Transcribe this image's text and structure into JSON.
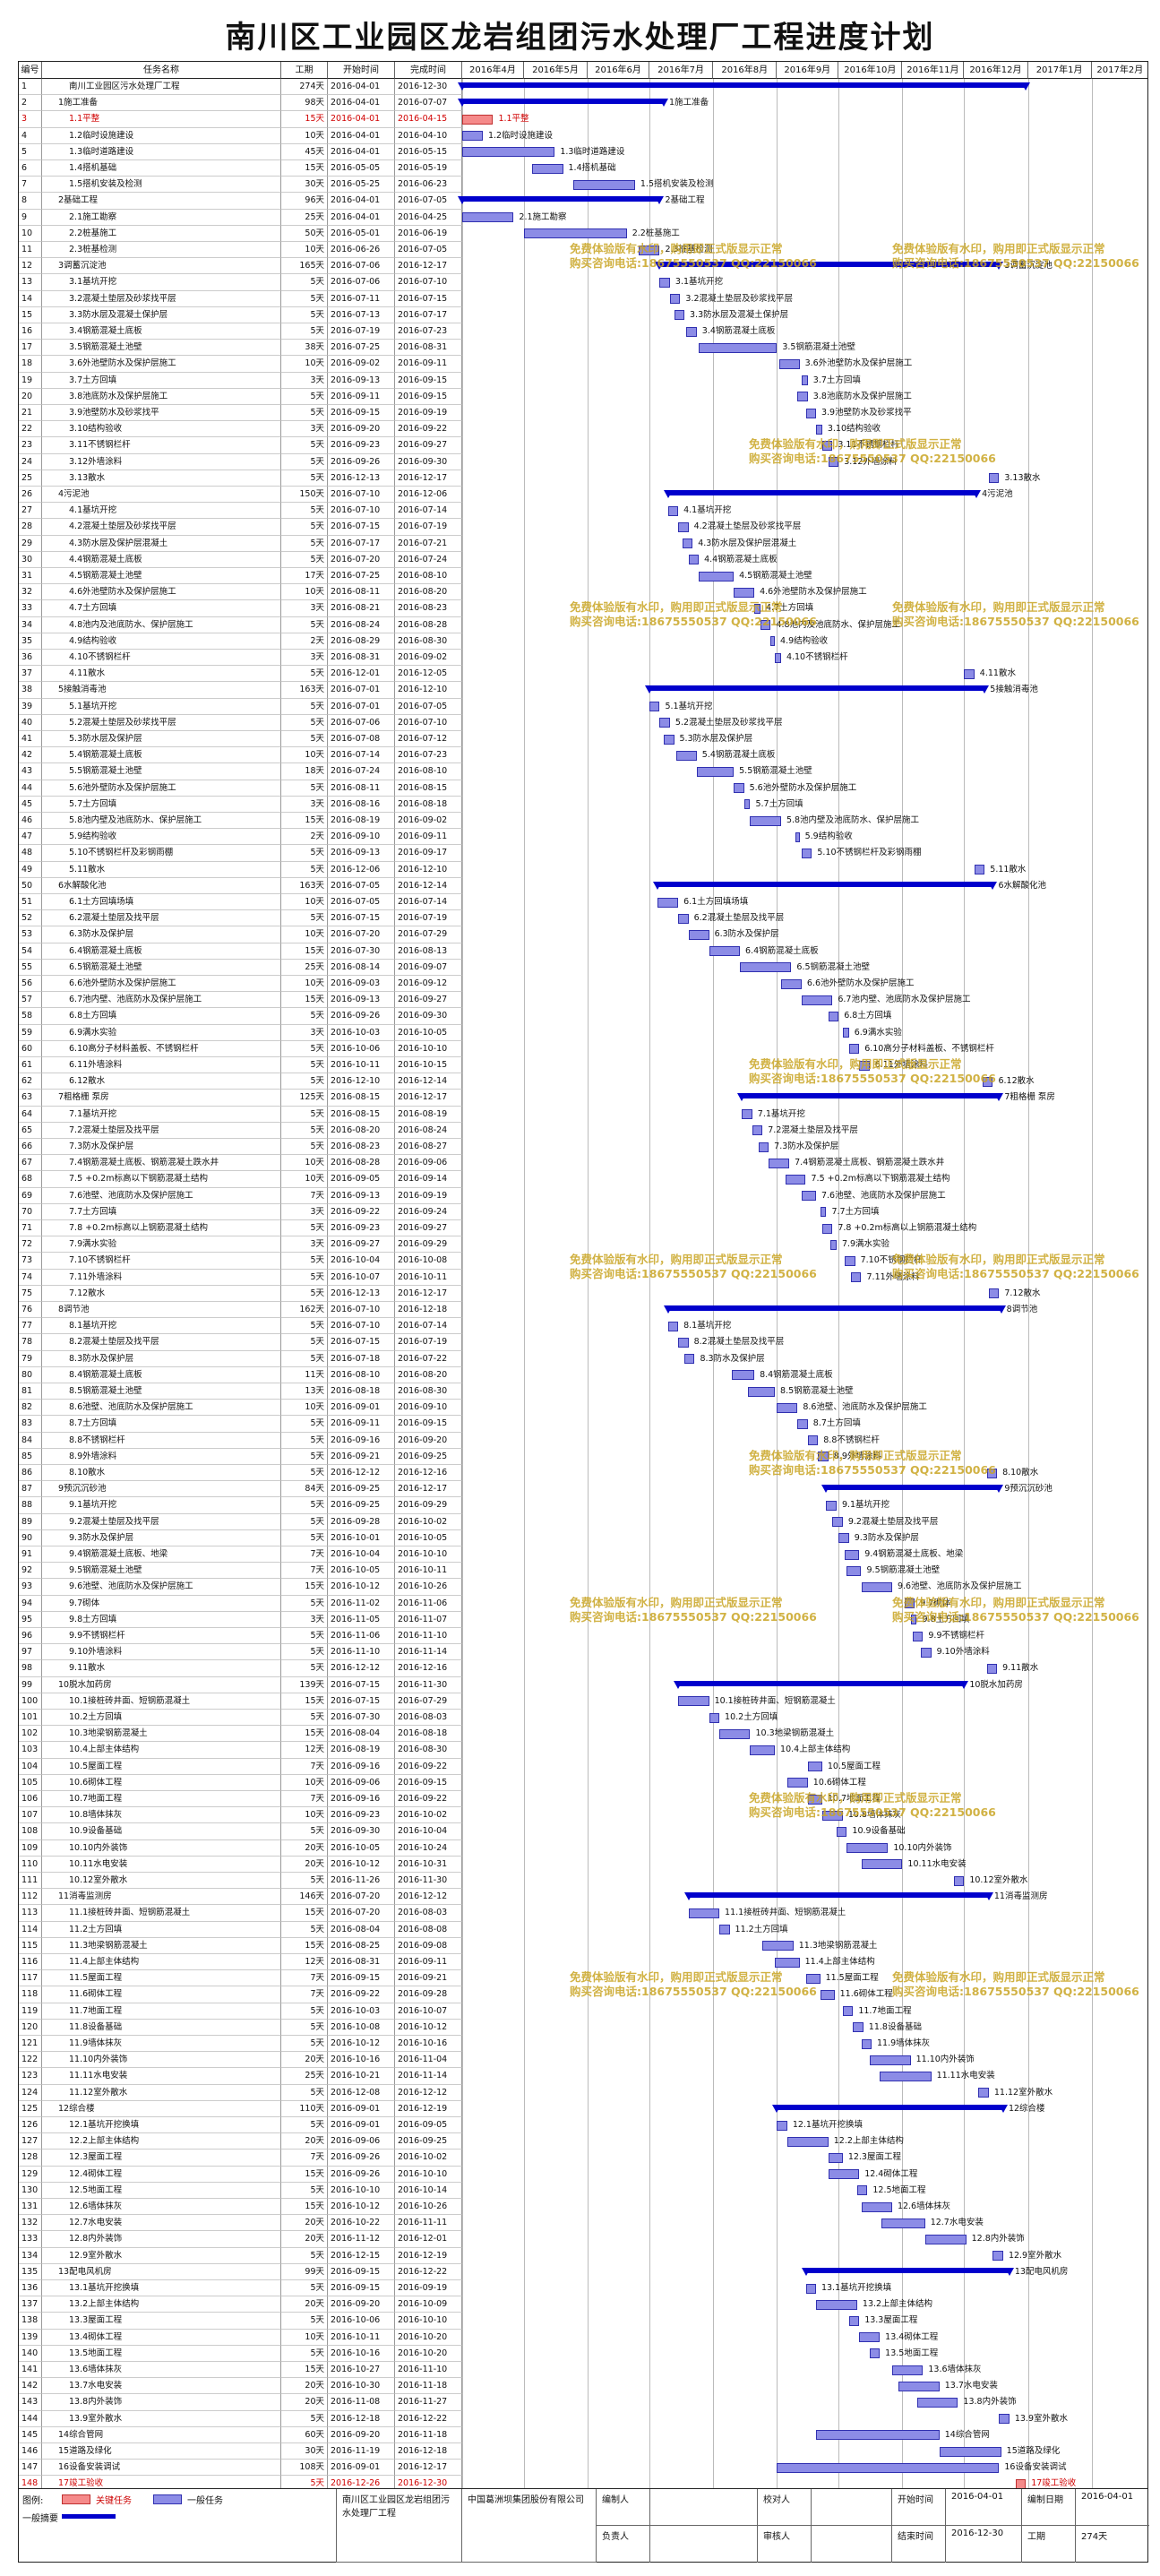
{
  "title": "南川区工业园区龙岩组团污水处理厂工程进度计划",
  "header": {
    "id": "编号",
    "name": "任务名称",
    "duration": "工期",
    "start": "开始时间",
    "end": "完成时间",
    "months": [
      "2016年4月",
      "2016年5月",
      "2016年6月",
      "2016年7月",
      "2016年8月",
      "2016年9月",
      "2016年10月",
      "2016年11月",
      "2016年12月",
      "2017年1月",
      "2017年2月"
    ]
  },
  "chart_data": {
    "type": "gantt",
    "timeline_start": "2016-04-01",
    "timeline_end": "2017-02-28",
    "columns": [
      "id",
      "name",
      "duration",
      "start",
      "end",
      "type"
    ],
    "rows": [
      [
        1,
        "南川工业园区污水处理厂工程",
        "274天",
        "2016-04-01",
        "2016-12-30",
        "summary"
      ],
      [
        2,
        "1施工准备",
        "98天",
        "2016-04-01",
        "2016-07-07",
        "summary"
      ],
      [
        3,
        "1.1平整",
        "15天",
        "2016-04-01",
        "2016-04-15",
        "crit"
      ],
      [
        4,
        "1.2临时设施建设",
        "10天",
        "2016-04-01",
        "2016-04-10",
        "task"
      ],
      [
        5,
        "1.3临时道路建设",
        "45天",
        "2016-04-01",
        "2016-05-15",
        "task"
      ],
      [
        6,
        "1.4搭机基础",
        "15天",
        "2016-05-05",
        "2016-05-19",
        "task"
      ],
      [
        7,
        "1.5搭机安装及检测",
        "30天",
        "2016-05-25",
        "2016-06-23",
        "task"
      ],
      [
        8,
        "2基础工程",
        "96天",
        "2016-04-01",
        "2016-07-05",
        "summary"
      ],
      [
        9,
        "2.1施工勘察",
        "25天",
        "2016-04-01",
        "2016-04-25",
        "task"
      ],
      [
        10,
        "2.2桩基施工",
        "50天",
        "2016-05-01",
        "2016-06-19",
        "task"
      ],
      [
        11,
        "2.3桩基检测",
        "10天",
        "2016-06-26",
        "2016-07-05",
        "task"
      ],
      [
        12,
        "3调蓄沉淀池",
        "165天",
        "2016-07-06",
        "2016-12-17",
        "summary"
      ],
      [
        13,
        "3.1基坑开挖",
        "5天",
        "2016-07-06",
        "2016-07-10",
        "task"
      ],
      [
        14,
        "3.2混凝土垫层及砂浆找平层",
        "5天",
        "2016-07-11",
        "2016-07-15",
        "task"
      ],
      [
        15,
        "3.3防水层及混凝土保护层",
        "5天",
        "2016-07-13",
        "2016-07-17",
        "task"
      ],
      [
        16,
        "3.4钢筋混凝土底板",
        "5天",
        "2016-07-19",
        "2016-07-23",
        "task"
      ],
      [
        17,
        "3.5钢筋混凝土池壁",
        "38天",
        "2016-07-25",
        "2016-08-31",
        "task"
      ],
      [
        18,
        "3.6外池壁防水及保护层施工",
        "10天",
        "2016-09-02",
        "2016-09-11",
        "task"
      ],
      [
        19,
        "3.7土方回填",
        "3天",
        "2016-09-13",
        "2016-09-15",
        "task"
      ],
      [
        20,
        "3.8池底防水及保护层施工",
        "5天",
        "2016-09-11",
        "2016-09-15",
        "task"
      ],
      [
        21,
        "3.9池壁防水及砂浆找平",
        "5天",
        "2016-09-15",
        "2016-09-19",
        "task"
      ],
      [
        22,
        "3.10结构验收",
        "3天",
        "2016-09-20",
        "2016-09-22",
        "task"
      ],
      [
        23,
        "3.11不锈钢栏杆",
        "5天",
        "2016-09-23",
        "2016-09-27",
        "task"
      ],
      [
        24,
        "3.12外墙涂料",
        "5天",
        "2016-09-26",
        "2016-09-30",
        "task"
      ],
      [
        25,
        "3.13散水",
        "5天",
        "2016-12-13",
        "2016-12-17",
        "task"
      ],
      [
        26,
        "4污泥池",
        "150天",
        "2016-07-10",
        "2016-12-06",
        "summary"
      ],
      [
        27,
        "4.1基坑开挖",
        "5天",
        "2016-07-10",
        "2016-07-14",
        "task"
      ],
      [
        28,
        "4.2混凝土垫层及砂浆找平层",
        "5天",
        "2016-07-15",
        "2016-07-19",
        "task"
      ],
      [
        29,
        "4.3防水层及保护层混凝土",
        "5天",
        "2016-07-17",
        "2016-07-21",
        "task"
      ],
      [
        30,
        "4.4钢筋混凝土底板",
        "5天",
        "2016-07-20",
        "2016-07-24",
        "task"
      ],
      [
        31,
        "4.5钢筋混凝土池壁",
        "17天",
        "2016-07-25",
        "2016-08-10",
        "task"
      ],
      [
        32,
        "4.6外池壁防水及保护层施工",
        "10天",
        "2016-08-11",
        "2016-08-20",
        "task"
      ],
      [
        33,
        "4.7土方回填",
        "3天",
        "2016-08-21",
        "2016-08-23",
        "task"
      ],
      [
        34,
        "4.8池内及池底防水、保护层施工",
        "5天",
        "2016-08-24",
        "2016-08-28",
        "task"
      ],
      [
        35,
        "4.9结构验收",
        "2天",
        "2016-08-29",
        "2016-08-30",
        "task"
      ],
      [
        36,
        "4.10不锈钢栏杆",
        "3天",
        "2016-08-31",
        "2016-09-02",
        "task"
      ],
      [
        37,
        "4.11散水",
        "5天",
        "2016-12-01",
        "2016-12-05",
        "task"
      ],
      [
        38,
        "5接触消毒池",
        "163天",
        "2016-07-01",
        "2016-12-10",
        "summary"
      ],
      [
        39,
        "5.1基坑开挖",
        "5天",
        "2016-07-01",
        "2016-07-05",
        "task"
      ],
      [
        40,
        "5.2混凝土垫层及砂浆找平层",
        "5天",
        "2016-07-06",
        "2016-07-10",
        "task"
      ],
      [
        41,
        "5.3防水层及保护层",
        "5天",
        "2016-07-08",
        "2016-07-12",
        "task"
      ],
      [
        42,
        "5.4钢筋混凝土底板",
        "10天",
        "2016-07-14",
        "2016-07-23",
        "task"
      ],
      [
        43,
        "5.5钢筋混凝土池壁",
        "18天",
        "2016-07-24",
        "2016-08-10",
        "task"
      ],
      [
        44,
        "5.6池外壁防水及保护层施工",
        "5天",
        "2016-08-11",
        "2016-08-15",
        "task"
      ],
      [
        45,
        "5.7土方回填",
        "3天",
        "2016-08-16",
        "2016-08-18",
        "task"
      ],
      [
        46,
        "5.8池内壁及池底防水、保护层施工",
        "15天",
        "2016-08-19",
        "2016-09-02",
        "task"
      ],
      [
        47,
        "5.9结构验收",
        "2天",
        "2016-09-10",
        "2016-09-11",
        "task"
      ],
      [
        48,
        "5.10不锈钢栏杆及彩钢雨棚",
        "5天",
        "2016-09-13",
        "2016-09-17",
        "task"
      ],
      [
        49,
        "5.11散水",
        "5天",
        "2016-12-06",
        "2016-12-10",
        "task"
      ],
      [
        50,
        "6水解酸化池",
        "163天",
        "2016-07-05",
        "2016-12-14",
        "summary"
      ],
      [
        51,
        "6.1土方回填场填",
        "10天",
        "2016-07-05",
        "2016-07-14",
        "task"
      ],
      [
        52,
        "6.2混凝土垫层及找平层",
        "5天",
        "2016-07-15",
        "2016-07-19",
        "task"
      ],
      [
        53,
        "6.3防水及保护层",
        "10天",
        "2016-07-20",
        "2016-07-29",
        "task"
      ],
      [
        54,
        "6.4钢筋混凝土底板",
        "15天",
        "2016-07-30",
        "2016-08-13",
        "task"
      ],
      [
        55,
        "6.5钢筋混凝土池壁",
        "25天",
        "2016-08-14",
        "2016-09-07",
        "task"
      ],
      [
        56,
        "6.6池外壁防水及保护层施工",
        "10天",
        "2016-09-03",
        "2016-09-12",
        "task"
      ],
      [
        57,
        "6.7池内壁、池底防水及保护层施工",
        "15天",
        "2016-09-13",
        "2016-09-27",
        "task"
      ],
      [
        58,
        "6.8土方回填",
        "5天",
        "2016-09-26",
        "2016-09-30",
        "task"
      ],
      [
        59,
        "6.9满水实验",
        "3天",
        "2016-10-03",
        "2016-10-05",
        "task"
      ],
      [
        60,
        "6.10高分子材料盖板、不锈钢栏杆",
        "5天",
        "2016-10-06",
        "2016-10-10",
        "task"
      ],
      [
        61,
        "6.11外墙涂料",
        "5天",
        "2016-10-11",
        "2016-10-15",
        "task"
      ],
      [
        62,
        "6.12散水",
        "5天",
        "2016-12-10",
        "2016-12-14",
        "task"
      ],
      [
        63,
        "7粗格栅 泵房",
        "125天",
        "2016-08-15",
        "2016-12-17",
        "summary"
      ],
      [
        64,
        "7.1基坑开挖",
        "5天",
        "2016-08-15",
        "2016-08-19",
        "task"
      ],
      [
        65,
        "7.2混凝土垫层及找平层",
        "5天",
        "2016-08-20",
        "2016-08-24",
        "task"
      ],
      [
        66,
        "7.3防水及保护层",
        "5天",
        "2016-08-23",
        "2016-08-27",
        "task"
      ],
      [
        67,
        "7.4钢筋混凝土底板、钢筋混凝土跌水井",
        "10天",
        "2016-08-28",
        "2016-09-06",
        "task"
      ],
      [
        68,
        "7.5 +0.2m标高以下钢筋混凝土结构",
        "10天",
        "2016-09-05",
        "2016-09-14",
        "task"
      ],
      [
        69,
        "7.6池壁、池底防水及保护层施工",
        "7天",
        "2016-09-13",
        "2016-09-19",
        "task"
      ],
      [
        70,
        "7.7土方回填",
        "3天",
        "2016-09-22",
        "2016-09-24",
        "task"
      ],
      [
        71,
        "7.8 +0.2m标高以上钢筋混凝土结构",
        "5天",
        "2016-09-23",
        "2016-09-27",
        "task"
      ],
      [
        72,
        "7.9满水实验",
        "3天",
        "2016-09-27",
        "2016-09-29",
        "task"
      ],
      [
        73,
        "7.10不锈钢栏杆",
        "5天",
        "2016-10-04",
        "2016-10-08",
        "task"
      ],
      [
        74,
        "7.11外墙涂料",
        "5天",
        "2016-10-07",
        "2016-10-11",
        "task"
      ],
      [
        75,
        "7.12散水",
        "5天",
        "2016-12-13",
        "2016-12-17",
        "task"
      ],
      [
        76,
        "8调节池",
        "162天",
        "2016-07-10",
        "2016-12-18",
        "summary"
      ],
      [
        77,
        "8.1基坑开挖",
        "5天",
        "2016-07-10",
        "2016-07-14",
        "task"
      ],
      [
        78,
        "8.2混凝土垫层及找平层",
        "5天",
        "2016-07-15",
        "2016-07-19",
        "task"
      ],
      [
        79,
        "8.3防水及保护层",
        "5天",
        "2016-07-18",
        "2016-07-22",
        "task"
      ],
      [
        80,
        "8.4钢筋混凝土底板",
        "11天",
        "2016-08-10",
        "2016-08-20",
        "task"
      ],
      [
        81,
        "8.5钢筋混凝土池壁",
        "13天",
        "2016-08-18",
        "2016-08-30",
        "task"
      ],
      [
        82,
        "8.6池壁、池底防水及保护层施工",
        "10天",
        "2016-09-01",
        "2016-09-10",
        "task"
      ],
      [
        83,
        "8.7土方回填",
        "5天",
        "2016-09-11",
        "2016-09-15",
        "task"
      ],
      [
        84,
        "8.8不锈钢栏杆",
        "5天",
        "2016-09-16",
        "2016-09-20",
        "task"
      ],
      [
        85,
        "8.9外墙涂料",
        "5天",
        "2016-09-21",
        "2016-09-25",
        "task"
      ],
      [
        86,
        "8.10散水",
        "5天",
        "2016-12-12",
        "2016-12-16",
        "task"
      ],
      [
        87,
        "9预沉沉砂池",
        "84天",
        "2016-09-25",
        "2016-12-17",
        "summary"
      ],
      [
        88,
        "9.1基坑开挖",
        "5天",
        "2016-09-25",
        "2016-09-29",
        "task"
      ],
      [
        89,
        "9.2混凝土垫层及找平层",
        "5天",
        "2016-09-28",
        "2016-10-02",
        "task"
      ],
      [
        90,
        "9.3防水及保护层",
        "5天",
        "2016-10-01",
        "2016-10-05",
        "task"
      ],
      [
        91,
        "9.4钢筋混凝土底板、地梁",
        "7天",
        "2016-10-04",
        "2016-10-10",
        "task"
      ],
      [
        92,
        "9.5钢筋混凝土池壁",
        "7天",
        "2016-10-05",
        "2016-10-11",
        "task"
      ],
      [
        93,
        "9.6池壁、池底防水及保护层施工",
        "15天",
        "2016-10-12",
        "2016-10-26",
        "task"
      ],
      [
        94,
        "9.7砌体",
        "5天",
        "2016-11-02",
        "2016-11-06",
        "task"
      ],
      [
        95,
        "9.8土方回填",
        "3天",
        "2016-11-05",
        "2016-11-07",
        "task"
      ],
      [
        96,
        "9.9不锈钢栏杆",
        "5天",
        "2016-11-06",
        "2016-11-10",
        "task"
      ],
      [
        97,
        "9.10外墙涂料",
        "5天",
        "2016-11-10",
        "2016-11-14",
        "task"
      ],
      [
        98,
        "9.11散水",
        "5天",
        "2016-12-12",
        "2016-12-16",
        "task"
      ],
      [
        99,
        "10脱水加药房",
        "139天",
        "2016-07-15",
        "2016-11-30",
        "summary"
      ],
      [
        100,
        "10.1接桩砖井面、短钢筋混凝土",
        "15天",
        "2016-07-15",
        "2016-07-29",
        "task"
      ],
      [
        101,
        "10.2土方回填",
        "5天",
        "2016-07-30",
        "2016-08-03",
        "task"
      ],
      [
        102,
        "10.3地梁钢筋混凝土",
        "15天",
        "2016-08-04",
        "2016-08-18",
        "task"
      ],
      [
        103,
        "10.4上部主体结构",
        "12天",
        "2016-08-19",
        "2016-08-30",
        "task"
      ],
      [
        104,
        "10.5屋面工程",
        "7天",
        "2016-09-16",
        "2016-09-22",
        "task"
      ],
      [
        105,
        "10.6砌体工程",
        "10天",
        "2016-09-06",
        "2016-09-15",
        "task"
      ],
      [
        106,
        "10.7地面工程",
        "7天",
        "2016-09-16",
        "2016-09-22",
        "task"
      ],
      [
        107,
        "10.8墙体抹灰",
        "10天",
        "2016-09-23",
        "2016-10-02",
        "task"
      ],
      [
        108,
        "10.9设备基础",
        "5天",
        "2016-09-30",
        "2016-10-04",
        "task"
      ],
      [
        109,
        "10.10内外装饰",
        "20天",
        "2016-10-05",
        "2016-10-24",
        "task"
      ],
      [
        110,
        "10.11水电安装",
        "20天",
        "2016-10-12",
        "2016-10-31",
        "task"
      ],
      [
        111,
        "10.12室外散水",
        "5天",
        "2016-11-26",
        "2016-11-30",
        "task"
      ],
      [
        112,
        "11消毒监测房",
        "146天",
        "2016-07-20",
        "2016-12-12",
        "summary"
      ],
      [
        113,
        "11.1接桩砖井面、短钢筋混凝土",
        "15天",
        "2016-07-20",
        "2016-08-03",
        "task"
      ],
      [
        114,
        "11.2土方回填",
        "5天",
        "2016-08-04",
        "2016-08-08",
        "task"
      ],
      [
        115,
        "11.3地梁钢筋混凝土",
        "15天",
        "2016-08-25",
        "2016-09-08",
        "task"
      ],
      [
        116,
        "11.4上部主体结构",
        "12天",
        "2016-08-31",
        "2016-09-11",
        "task"
      ],
      [
        117,
        "11.5屋面工程",
        "7天",
        "2016-09-15",
        "2016-09-21",
        "task"
      ],
      [
        118,
        "11.6砌体工程",
        "7天",
        "2016-09-22",
        "2016-09-28",
        "task"
      ],
      [
        119,
        "11.7地面工程",
        "5天",
        "2016-10-03",
        "2016-10-07",
        "task"
      ],
      [
        120,
        "11.8设备基础",
        "5天",
        "2016-10-08",
        "2016-10-12",
        "task"
      ],
      [
        121,
        "11.9墙体抹灰",
        "5天",
        "2016-10-12",
        "2016-10-16",
        "task"
      ],
      [
        122,
        "11.10内外装饰",
        "20天",
        "2016-10-16",
        "2016-11-04",
        "task"
      ],
      [
        123,
        "11.11水电安装",
        "25天",
        "2016-10-21",
        "2016-11-14",
        "task"
      ],
      [
        124,
        "11.12室外散水",
        "5天",
        "2016-12-08",
        "2016-12-12",
        "task"
      ],
      [
        125,
        "12综合楼",
        "110天",
        "2016-09-01",
        "2016-12-19",
        "summary"
      ],
      [
        126,
        "12.1基坑开挖换填",
        "5天",
        "2016-09-01",
        "2016-09-05",
        "task"
      ],
      [
        127,
        "12.2上部主体结构",
        "20天",
        "2016-09-06",
        "2016-09-25",
        "task"
      ],
      [
        128,
        "12.3屋面工程",
        "7天",
        "2016-09-26",
        "2016-10-02",
        "task"
      ],
      [
        129,
        "12.4砌体工程",
        "15天",
        "2016-09-26",
        "2016-10-10",
        "task"
      ],
      [
        130,
        "12.5地面工程",
        "5天",
        "2016-10-10",
        "2016-10-14",
        "task"
      ],
      [
        131,
        "12.6墙体抹灰",
        "15天",
        "2016-10-12",
        "2016-10-26",
        "task"
      ],
      [
        132,
        "12.7水电安装",
        "20天",
        "2016-10-22",
        "2016-11-11",
        "task"
      ],
      [
        133,
        "12.8内外装饰",
        "20天",
        "2016-11-12",
        "2016-12-01",
        "task"
      ],
      [
        134,
        "12.9室外散水",
        "5天",
        "2016-12-15",
        "2016-12-19",
        "task"
      ],
      [
        135,
        "13配电风机房",
        "99天",
        "2016-09-15",
        "2016-12-22",
        "summary"
      ],
      [
        136,
        "13.1基坑开挖换填",
        "5天",
        "2016-09-15",
        "2016-09-19",
        "task"
      ],
      [
        137,
        "13.2上部主体结构",
        "20天",
        "2016-09-20",
        "2016-10-09",
        "task"
      ],
      [
        138,
        "13.3屋面工程",
        "5天",
        "2016-10-06",
        "2016-10-10",
        "task"
      ],
      [
        139,
        "13.4砌体工程",
        "10天",
        "2016-10-11",
        "2016-10-20",
        "task"
      ],
      [
        140,
        "13.5地面工程",
        "5天",
        "2016-10-16",
        "2016-10-20",
        "task"
      ],
      [
        141,
        "13.6墙体抹灰",
        "15天",
        "2016-10-27",
        "2016-11-10",
        "task"
      ],
      [
        142,
        "13.7水电安装",
        "20天",
        "2016-10-30",
        "2016-11-18",
        "task"
      ],
      [
        143,
        "13.8内外装饰",
        "20天",
        "2016-11-08",
        "2016-11-27",
        "task"
      ],
      [
        144,
        "13.9室外散水",
        "5天",
        "2016-12-18",
        "2016-12-22",
        "task"
      ],
      [
        145,
        "14综合管网",
        "60天",
        "2016-09-20",
        "2016-11-18",
        "task"
      ],
      [
        146,
        "15道路及绿化",
        "30天",
        "2016-11-19",
        "2016-12-18",
        "task"
      ],
      [
        147,
        "16设备安装调试",
        "108天",
        "2016-09-01",
        "2016-12-17",
        "task"
      ],
      [
        148,
        "17竣工验收",
        "5天",
        "2016-12-26",
        "2016-12-30",
        "crit"
      ]
    ]
  },
  "watermark": {
    "line1": "免费体验版有水印，购用即正式版显示正常",
    "line2": "购买咨询电话:18675550537 QQ:22150066"
  },
  "footer": {
    "legend_title": "图例:",
    "legend_crit": "关键任务",
    "legend_task": "一般任务",
    "legend_summary": "一般摘要",
    "project": "南川区工业园区龙岩组团污水处理厂工程",
    "company": "中国葛洲坝集团股份有限公司",
    "compiler_label": "编制人",
    "checker_label": "校对人",
    "manager_label": "负责人",
    "reviewer_label": "审核人",
    "start_label": "开始时间",
    "start_value": "2016-04-01",
    "date_label": "编制日期",
    "date_value": "2016-04-01",
    "end_label": "结束时间",
    "end_value": "2016-12-30",
    "dur_label": "工期",
    "dur_value": "274天"
  }
}
